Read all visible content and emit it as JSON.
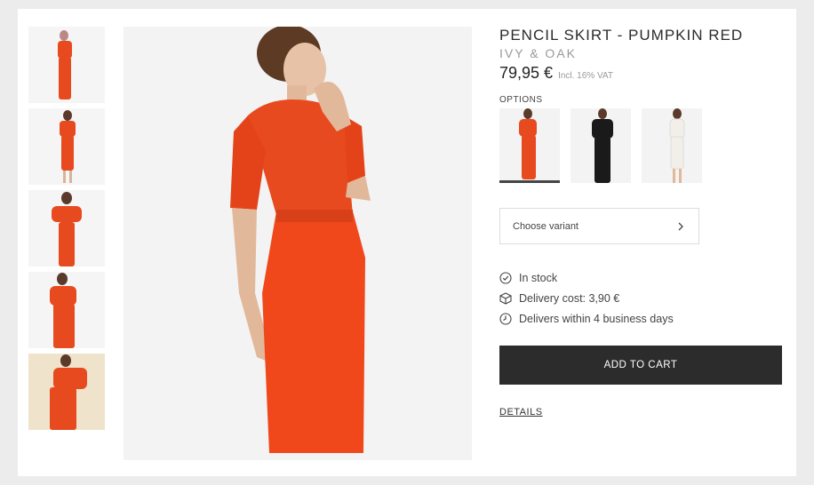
{
  "product": {
    "title": "PENCIL SKIRT - PUMPKIN RED",
    "brand": "IVY & OAK",
    "price": "79,95 €",
    "vat_note": "Incl. 16% VAT"
  },
  "options": {
    "label": "OPTIONS",
    "items": [
      {
        "name": "pumpkin red",
        "color": "#e84a1f",
        "selected": true
      },
      {
        "name": "black",
        "color": "#1a1a1a",
        "selected": false
      },
      {
        "name": "white",
        "color": "#f2efe8",
        "selected": false
      }
    ]
  },
  "variant": {
    "placeholder": "Choose variant",
    "icon": "chevron-right-icon"
  },
  "features": [
    {
      "icon": "check-badge-icon",
      "text": "In stock"
    },
    {
      "icon": "package-icon",
      "text": "Delivery cost: 3,90 €"
    },
    {
      "icon": "clock-icon",
      "text": "Delivers within 4 business days"
    }
  ],
  "actions": {
    "add_to_cart": "ADD TO CART",
    "details": "DETAILS"
  },
  "colors": {
    "accent": "#2c2c2c",
    "product": "#e84a1f",
    "background": "#ececec"
  }
}
